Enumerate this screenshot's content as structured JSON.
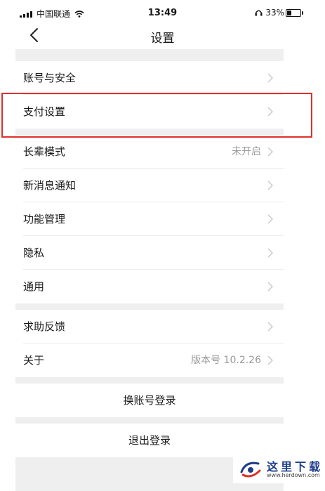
{
  "status_bar": {
    "carrier": "中国联通",
    "time": "13:49",
    "battery_percent": "33%",
    "battery_level": 0.33
  },
  "nav": {
    "title": "设置"
  },
  "groups": {
    "account": [
      {
        "label": "账号与安全"
      },
      {
        "label": "支付设置"
      }
    ],
    "main": [
      {
        "label": "长辈模式",
        "value": "未开启"
      },
      {
        "label": "新消息通知"
      },
      {
        "label": "功能管理"
      },
      {
        "label": "隐私"
      },
      {
        "label": "通用"
      }
    ],
    "help": [
      {
        "label": "求助反馈"
      },
      {
        "label": "关于",
        "value": "版本号 10.2.26"
      }
    ]
  },
  "actions": {
    "switch_account": "换账号登录",
    "logout": "退出登录"
  },
  "colors": {
    "highlight": "#e0302a",
    "separator_bg": "#efefef",
    "secondary_text": "#999999"
  }
}
